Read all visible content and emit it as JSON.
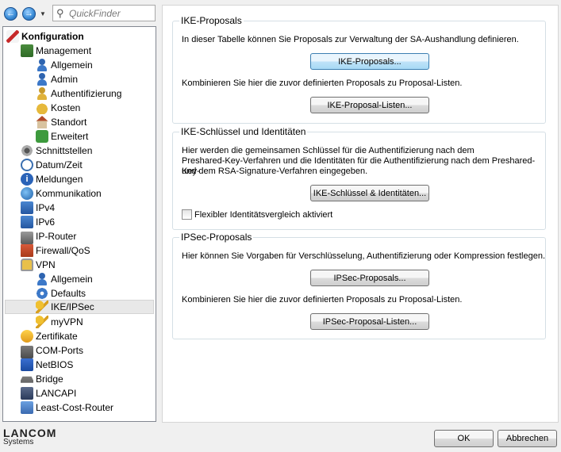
{
  "toolbar": {
    "quickfinder_placeholder": "QuickFinder"
  },
  "tree": {
    "items": [
      {
        "label": "Konfiguration",
        "icon": "wrench-icon"
      },
      {
        "label": "Management",
        "icon": "management-icon"
      },
      {
        "label": "Allgemein",
        "icon": "user-icon"
      },
      {
        "label": "Admin",
        "icon": "user-icon"
      },
      {
        "label": "Authentifizierung",
        "icon": "user-key-icon"
      },
      {
        "label": "Kosten",
        "icon": "coins-icon"
      },
      {
        "label": "Standort",
        "icon": "house-icon"
      },
      {
        "label": "Erweitert",
        "icon": "advanced-icon"
      },
      {
        "label": "Schnittstellen",
        "icon": "interfaces-icon"
      },
      {
        "label": "Datum/Zeit",
        "icon": "clock-icon"
      },
      {
        "label": "Meldungen",
        "icon": "info-icon"
      },
      {
        "label": "Kommunikation",
        "icon": "globe-icon"
      },
      {
        "label": "IPv4",
        "icon": "network-icon"
      },
      {
        "label": "IPv6",
        "icon": "network-icon"
      },
      {
        "label": "IP-Router",
        "icon": "router-icon"
      },
      {
        "label": "Firewall/QoS",
        "icon": "firewall-icon"
      },
      {
        "label": "VPN",
        "icon": "lock-icon"
      },
      {
        "label": "Allgemein",
        "icon": "user-icon"
      },
      {
        "label": "Defaults",
        "icon": "gear-icon"
      },
      {
        "label": "IKE/IPSec",
        "icon": "key-icon"
      },
      {
        "label": "myVPN",
        "icon": "key-icon"
      },
      {
        "label": "Zertifikate",
        "icon": "certificate-icon"
      },
      {
        "label": "COM-Ports",
        "icon": "com-port-icon"
      },
      {
        "label": "NetBIOS",
        "icon": "netbios-icon"
      },
      {
        "label": "Bridge",
        "icon": "bridge-icon"
      },
      {
        "label": "LANCAPI",
        "icon": "lancapi-icon"
      },
      {
        "label": "Least-Cost-Router",
        "icon": "lcr-icon"
      }
    ]
  },
  "ike_proposals": {
    "legend": "IKE-Proposals",
    "text1": "In dieser Tabelle können Sie Proposals zur Verwaltung der SA-Aushandlung definieren.",
    "button1": "IKE-Proposals...",
    "text2": "Kombinieren Sie hier die zuvor definierten Proposals zu Proposal-Listen.",
    "button2": "IKE-Proposal-Listen..."
  },
  "ike_keys": {
    "legend": "IKE-Schlüssel und Identitäten",
    "line1": "Hier werden die gemeinsamen Schlüssel für die Authentifizierung nach dem",
    "line2": "Preshared-Key-Verfahren und die Identitäten für die Authentifizierung nach dem Preshared-Key-",
    "line3": "und dem RSA-Signature-Verfahren eingegeben.",
    "button": "IKE-Schlüssel & Identitäten...",
    "checkbox_label": "Flexibler Identitätsvergleich aktiviert",
    "checkbox_checked": false
  },
  "ipsec_proposals": {
    "legend": "IPSec-Proposals",
    "text1": "Hier können Sie Vorgaben für Verschlüsselung, Authentifizierung oder Kompression festlegen.",
    "button1": "IPSec-Proposals...",
    "text2": "Kombinieren Sie hier die zuvor definierten Proposals zu Proposal-Listen.",
    "button2": "IPSec-Proposal-Listen..."
  },
  "footer": {
    "brand": "LANCOM",
    "brand_sub": "Systems",
    "ok_label": "OK",
    "cancel_label": "Abbrechen"
  }
}
